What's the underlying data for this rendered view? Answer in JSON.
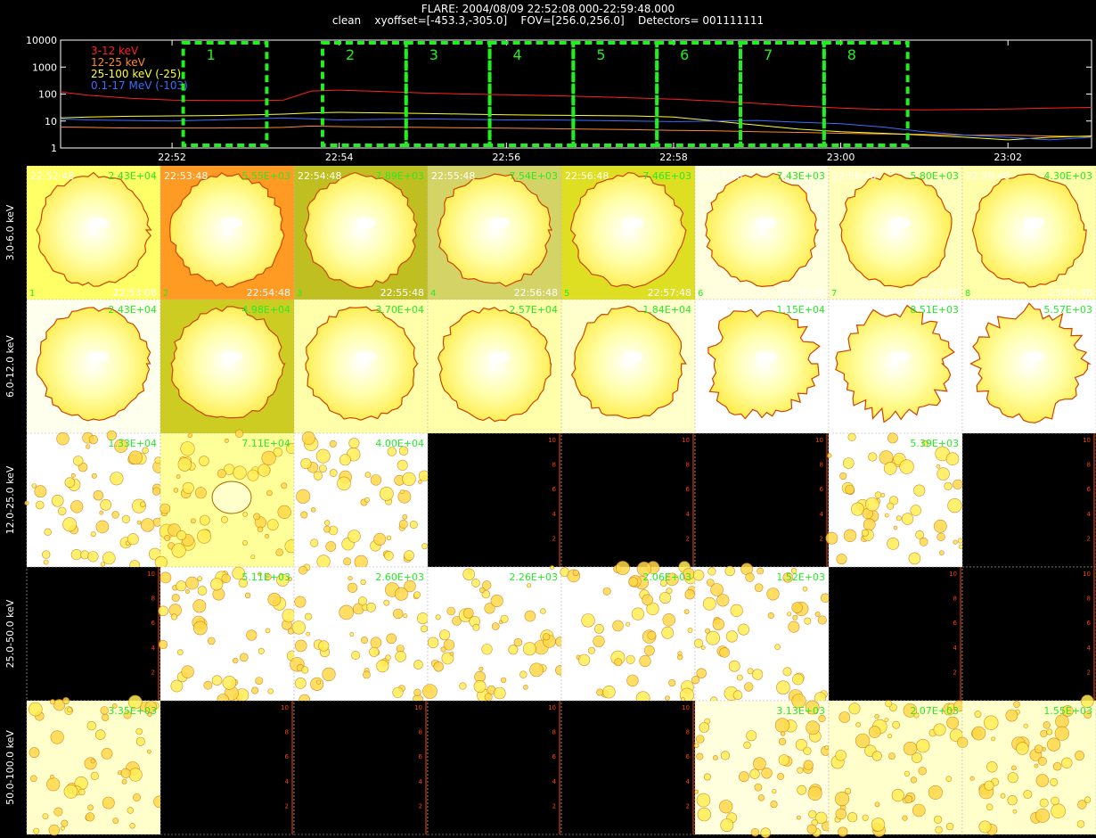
{
  "title": {
    "line1": "FLARE: 2004/08/09 22:52:08.000-22:59:48.000",
    "line2": "clean    xyoffset=[-453.3,-305.0]    FOV=[256.0,256.0]    Detectors= 001111111"
  },
  "colors": {
    "band_3_12": "#ff2020",
    "band_12_25": "#ff8a2a",
    "band_25_100": "#ffff30",
    "band_100_17000": "#3a6dff",
    "interval_box": "#22ee22",
    "label_green": "#22ee22",
    "empty_panel": "#000000"
  },
  "chart_data": [
    {
      "type": "line",
      "title": "",
      "xlabel": "",
      "ylabel": "",
      "yscale": "log",
      "ylim": [
        1,
        10000
      ],
      "xlim": [
        "22:50:40",
        "23:03:00"
      ],
      "y_ticks": [
        "1",
        "10",
        "100",
        "1000",
        "10000"
      ],
      "x_ticks": [
        "22:52",
        "22:54",
        "22:56",
        "22:58",
        "23:00",
        "23:02"
      ],
      "x": [
        "22:50:40",
        "22:51:00",
        "22:51:30",
        "22:52:00",
        "22:52:30",
        "22:53:00",
        "22:53:20",
        "22:53:40",
        "22:54:00",
        "22:54:30",
        "22:55:00",
        "22:55:30",
        "22:56:00",
        "22:56:30",
        "22:57:00",
        "22:57:30",
        "22:58:00",
        "22:58:30",
        "22:59:00",
        "22:59:30",
        "23:00:00",
        "23:00:30",
        "23:01:00",
        "23:01:30",
        "23:02:00",
        "23:02:30",
        "23:03:00"
      ],
      "series": [
        {
          "name": "3-12 keV",
          "values": [
            120,
            90,
            70,
            60,
            58,
            57,
            60,
            130,
            140,
            125,
            110,
            100,
            95,
            88,
            80,
            72,
            65,
            55,
            45,
            36,
            30,
            27,
            26,
            27,
            28,
            30,
            32
          ]
        },
        {
          "name": "12-25 keV",
          "values": [
            6,
            5.8,
            5.5,
            5.5,
            5.5,
            5.6,
            5.8,
            6.5,
            6.2,
            6,
            5.8,
            5.6,
            5.4,
            5.2,
            5,
            4.8,
            4.5,
            4.3,
            4,
            3.8,
            3.5,
            3.3,
            3.2,
            3,
            3,
            2.8,
            2.6
          ]
        },
        {
          "name": "25-100 keV (-25)",
          "values": [
            13,
            14,
            15,
            15.5,
            16,
            17,
            18,
            20,
            21,
            20,
            19,
            18,
            17,
            16.5,
            16,
            15.5,
            14,
            10,
            7,
            5,
            4,
            3.5,
            3,
            2.5,
            2,
            2.5,
            2.8
          ]
        },
        {
          "name": "0.1-17 MeV (-103)",
          "values": [
            12,
            11,
            10.5,
            10,
            11,
            12,
            13,
            12,
            11,
            11.5,
            12,
            11.5,
            11,
            11,
            10.5,
            10,
            9.5,
            10,
            10.5,
            9,
            8,
            6,
            4,
            3,
            2.5,
            2,
            2.5
          ]
        }
      ],
      "intervals": [
        {
          "label": "1",
          "start": "22:52:08",
          "end": "22:53:08"
        },
        {
          "label": "2",
          "start": "22:53:48",
          "end": "22:54:48"
        },
        {
          "label": "3",
          "start": "22:54:48",
          "end": "22:55:48"
        },
        {
          "label": "4",
          "start": "22:55:48",
          "end": "22:56:48"
        },
        {
          "label": "5",
          "start": "22:56:48",
          "end": "22:57:48"
        },
        {
          "label": "6",
          "start": "22:57:48",
          "end": "22:58:48"
        },
        {
          "label": "7",
          "start": "22:58:48",
          "end": "22:59:48"
        },
        {
          "label": "8",
          "start": "22:59:48",
          "end": "23:00:48"
        }
      ]
    },
    {
      "type": "heatmap",
      "title": "",
      "energy_bands": [
        "3.0-6.0 keV",
        "6.0-12.0 keV",
        "12.0-25.0 keV",
        "25.0-50.0 keV",
        "50.0-100.0 keV"
      ],
      "intervals": [
        "1",
        "2",
        "3",
        "4",
        "5",
        "6",
        "7",
        "8"
      ],
      "start_times": [
        "22:52:48",
        "22:53:48",
        "22:54:48",
        "22:55:48",
        "22:56:48",
        "22:57:48",
        "22:58:48",
        "22:59:48"
      ],
      "end_times": [
        "22:53:08",
        "22:54:48",
        "22:55:48",
        "22:56:48",
        "22:57:48",
        "22:58:48",
        "22:59:48",
        "23:00:48"
      ],
      "peak_values": [
        [
          "2.43E+04",
          "5.55E+03",
          "7.89E+03",
          "7.54E+03",
          "7.46E+03",
          "7.43E+03",
          "5.80E+03",
          "4.30E+03"
        ],
        [
          "2.43E+04",
          "4.98E+04",
          "3.70E+04",
          "2.57E+04",
          "1.84E+04",
          "1.15E+04",
          "8.51E+03",
          "5.57E+03"
        ],
        [
          "1.33E+04",
          "7.11E+04",
          "4.00E+04",
          "",
          "",
          "",
          "5.39E+03",
          ""
        ],
        [
          "",
          "5.11E+03",
          "2.60E+03",
          "2.26E+03",
          "2.06E+03",
          "1.52E+03",
          "",
          ""
        ],
        [
          "3.35E+03",
          "",
          "",
          "",
          "",
          "3.13E+03",
          "2.07E+03",
          "1.55E+03"
        ]
      ],
      "empty_panel_axis_ticks": [
        "2",
        "4",
        "6",
        "8",
        "10"
      ],
      "panel_style": [
        [
          "disk",
          "disk",
          "disk",
          "disk",
          "disk",
          "disk",
          "disk",
          "disk"
        ],
        [
          "disk",
          "disk",
          "disk",
          "disk",
          "disk",
          "rough",
          "rough",
          "rough"
        ],
        [
          "noise",
          "blob",
          "noise",
          "empty",
          "empty",
          "empty",
          "noise",
          "empty"
        ],
        [
          "empty",
          "noise",
          "noise",
          "noise",
          "noise",
          "noise",
          "empty",
          "empty"
        ],
        [
          "noise",
          "empty",
          "empty",
          "empty",
          "empty",
          "noise",
          "noise",
          "noise"
        ]
      ],
      "panel_bg": [
        [
          "#ffff66",
          "#ff9a22",
          "#bfbf22",
          "#d4d466",
          "#dede22",
          "#ffffdd",
          "#ffffbb",
          "#ffffaa"
        ],
        [
          "#ffffee",
          "#cccc22",
          "#ffffaa",
          "#ffffaa",
          "#ffffcc",
          "#ffffff",
          "#ffffff",
          "#ffffff"
        ],
        [
          "#ffffff",
          "#ffff99",
          "#ffffff",
          "#000000",
          "#000000",
          "#000000",
          "#ffffff",
          "#000000"
        ],
        [
          "#000000",
          "#ffffff",
          "#ffffff",
          "#ffffff",
          "#ffffff",
          "#ffffff",
          "#000000",
          "#000000"
        ],
        [
          "#ffffcc",
          "#000000",
          "#000000",
          "#000000",
          "#000000",
          "#ffffdd",
          "#ffffcc",
          "#ffffcc"
        ]
      ]
    }
  ]
}
